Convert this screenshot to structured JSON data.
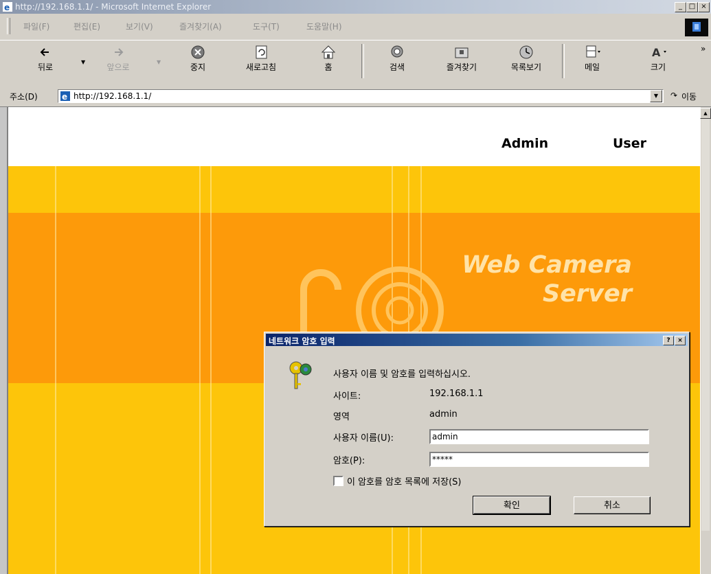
{
  "window": {
    "title": "http://192.168.1.1/ - Microsoft Internet Explorer",
    "controls": [
      "_",
      "□",
      "×"
    ]
  },
  "menubar": {
    "items": [
      "파일(F)",
      "편집(E)",
      "보기(V)",
      "즐겨찾기(A)",
      "도구(T)",
      "도움말(H)"
    ]
  },
  "toolbar": {
    "back": "뒤로",
    "forward": "앞으로",
    "stop": "중지",
    "refresh": "새로고침",
    "home": "홈",
    "search": "검색",
    "favorites": "즐겨찾기",
    "history": "목록보기",
    "mail": "메일",
    "size": "크기",
    "chevron": "»"
  },
  "addressbar": {
    "label": "주소(D)",
    "url": "http://192.168.1.1/",
    "go_label": "이동",
    "go_glyph": "↷"
  },
  "page": {
    "nav": {
      "admin": "Admin",
      "user": "User"
    },
    "brand_line1": "Web Camera",
    "brand_line2": "Server",
    "colors": {
      "yellow": "#fdc50a",
      "orange": "#fd9a0a"
    }
  },
  "dialog": {
    "title": "네트워크 암호 입력",
    "help_btn": "?",
    "close_btn": "×",
    "prompt": "사용자 이름 및 암호를 입력하십시오.",
    "site_label": "사이트:",
    "site_value": "192.168.1.1",
    "realm_label": "영역",
    "realm_value": "admin",
    "username_label": "사용자 이름(U):",
    "username_value": "admin",
    "password_label": "암호(P):",
    "password_value": "*****",
    "save_label": "이 암호를 암호 목록에 저장(S)",
    "save_checked": false,
    "ok": "확인",
    "cancel": "취소"
  }
}
